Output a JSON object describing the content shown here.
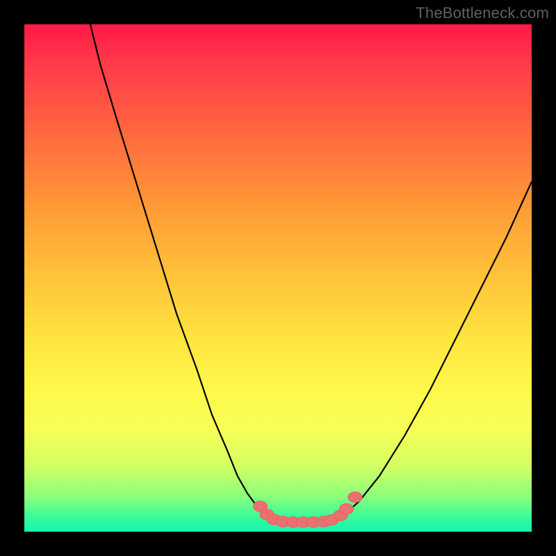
{
  "watermark": "TheBottleneck.com",
  "colors": {
    "frame": "#000000",
    "curve": "#000000",
    "beads_fill": "#ED7070",
    "beads_stroke": "#E7605C",
    "gradient_css": "linear-gradient(to bottom, #ff1a46 0%, #ff3b4a 8%, #ff6a3e 22%, #ff9a36 36%, #ffc43a 50%, #ffe43f 62%, #fff84a 72%, #f7ff56 80%, #d3ff63 87%, #8cff7a 93%, #3afc9a 97%, #18f4b0 100%)"
  },
  "chart_data": {
    "type": "line",
    "title": "",
    "xlabel": "",
    "ylabel": "",
    "xlim": [
      0,
      100
    ],
    "ylim": [
      0,
      100
    ],
    "series": [
      {
        "name": "left-branch",
        "x": [
          13,
          15,
          18,
          22,
          26,
          30,
          34,
          37,
          40,
          42,
          44,
          46,
          47.5,
          48.5
        ],
        "y": [
          100,
          92,
          82,
          69,
          56,
          43,
          32,
          23,
          16,
          11,
          7.5,
          4.8,
          3.2,
          2.4
        ]
      },
      {
        "name": "bottom-flat",
        "x": [
          48.5,
          50,
          52,
          54,
          56,
          58,
          60,
          61.5
        ],
        "y": [
          2.4,
          2.0,
          1.9,
          1.9,
          1.9,
          2.0,
          2.2,
          2.5
        ]
      },
      {
        "name": "right-branch",
        "x": [
          61.5,
          63,
          66,
          70,
          75,
          80,
          85,
          90,
          95,
          100
        ],
        "y": [
          2.5,
          3.3,
          6.0,
          11,
          19,
          28,
          38,
          48,
          58,
          69
        ]
      }
    ],
    "markers": {
      "name": "beads",
      "points": [
        {
          "x": 46.5,
          "y": 5.0
        },
        {
          "x": 47.8,
          "y": 3.4
        },
        {
          "x": 49.2,
          "y": 2.4
        },
        {
          "x": 51.0,
          "y": 2.0
        },
        {
          "x": 53.0,
          "y": 1.9
        },
        {
          "x": 55.0,
          "y": 1.9
        },
        {
          "x": 57.0,
          "y": 1.9
        },
        {
          "x": 59.0,
          "y": 2.0
        },
        {
          "x": 60.5,
          "y": 2.3
        },
        {
          "x": 62.3,
          "y": 3.2
        },
        {
          "x": 63.5,
          "y": 4.5
        },
        {
          "x": 65.2,
          "y": 6.8
        }
      ],
      "radius_pct": 1.1
    }
  }
}
